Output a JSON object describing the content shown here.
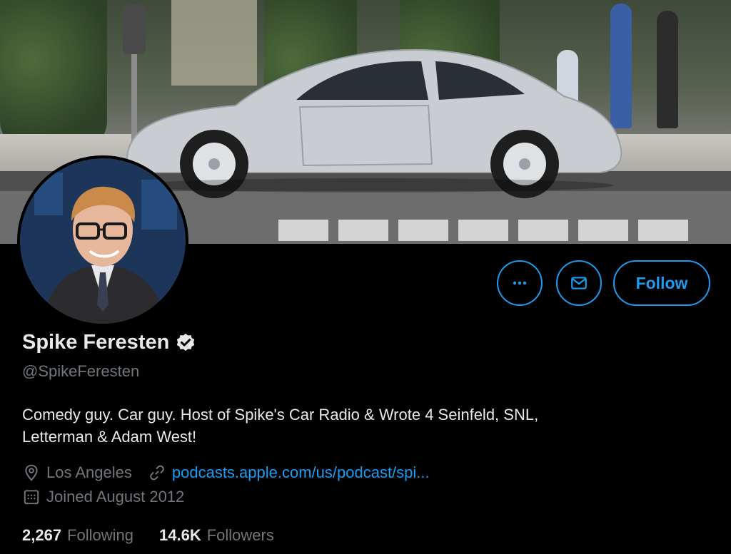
{
  "profile": {
    "display_name": "Spike Feresten",
    "handle": "@SpikeFeresten",
    "bio_line1": "Comedy guy. Car guy. Host of Spike's Car Radio & Wrote 4 Seinfeld, SNL,",
    "bio_line2": "Letterman & Adam West!",
    "location": "Los Angeles",
    "website": "podcasts.apple.com/us/podcast/spi...",
    "joined": "Joined August 2012",
    "verified_icon": "verified-badge-icon"
  },
  "actions": {
    "follow_label": "Follow",
    "more_icon": "more-icon",
    "message_icon": "envelope-icon"
  },
  "stats": {
    "following_count": "2,267",
    "following_label": "Following",
    "followers_count": "14.6K",
    "followers_label": "Followers"
  },
  "colors": {
    "accent": "#1d9bf0",
    "background": "#000000",
    "text_primary": "#e7e9ea",
    "text_secondary": "#71767b"
  }
}
